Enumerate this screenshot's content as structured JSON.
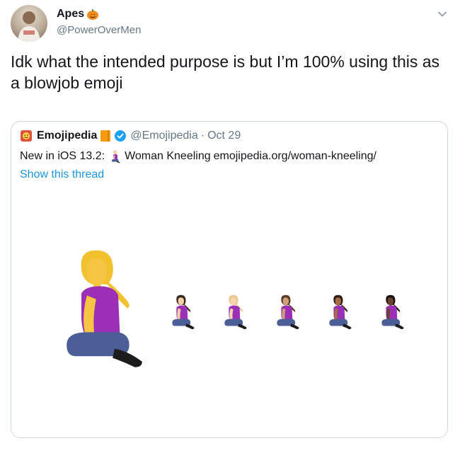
{
  "tweet": {
    "display_name": "Apes",
    "handle": "@PowerOverMen",
    "text": "Idk what the intended purpose is but I’m 100% using this as a blowjob emoji"
  },
  "quote": {
    "name": "Emojipedia",
    "handle": "@Emojipedia",
    "separator": "·",
    "date": "Oct 29",
    "text_prefix": "New in iOS 13.2:",
    "text_desc": "Woman Kneeling",
    "text_link": "emojipedia.org/woman-kneeling/",
    "show_thread": "Show this thread"
  },
  "icons": {
    "name_emoji": "pumpkin-icon",
    "logo": "emojipedia-logo-icon",
    "badge_book": "book-icon",
    "verified": "verified-icon",
    "menu": "chevron-down-icon"
  },
  "colors": {
    "link": "#1b95e0",
    "verified": "#1da1f2",
    "secondary_text": "#657786",
    "border": "#ccd6dd"
  },
  "emoji_variants": [
    {
      "hair": "#3a2a1e",
      "skin": "#f6cfa8"
    },
    {
      "hair": "#e7c98b",
      "skin": "#f6d3b1"
    },
    {
      "hair": "#5a3a22",
      "skin": "#cf9f78"
    },
    {
      "hair": "#2e1d12",
      "skin": "#a86d45"
    },
    {
      "hair": "#1a1210",
      "skin": "#6b4330"
    }
  ]
}
